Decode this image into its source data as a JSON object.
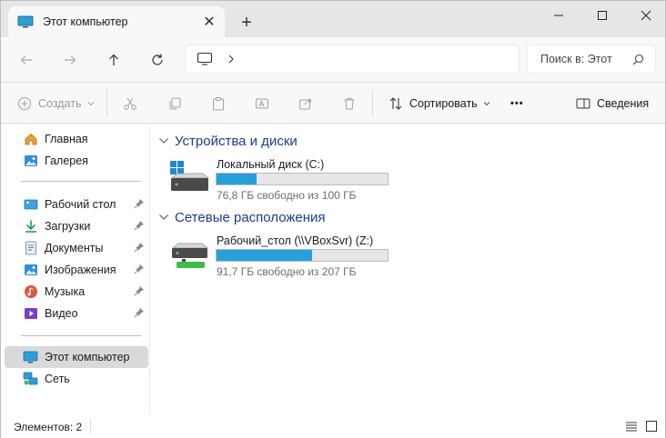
{
  "tab": {
    "title": "Этот компьютер",
    "close": "✕",
    "new_tab": "+"
  },
  "window": {
    "minimize": "—",
    "maximize": "☐",
    "close": "✕"
  },
  "nav": {
    "back": "back-arrow-icon",
    "forward": "forward-arrow-icon",
    "up": "up-arrow-icon",
    "refresh": "refresh-icon"
  },
  "address": {
    "path_chevron": "›"
  },
  "search": {
    "placeholder": "Поиск в: Этот компьютер",
    "shown": "Поиск в: Этот"
  },
  "toolbar": {
    "create": "Создать",
    "sort": "Сортировать",
    "more": "•••",
    "details": "Сведения"
  },
  "sidebar": {
    "items": [
      {
        "label": "Главная",
        "icon": "home-icon"
      },
      {
        "label": "Галерея",
        "icon": "gallery-icon"
      },
      {
        "label": "Рабочий стол",
        "icon": "desktop-icon",
        "pinned": true
      },
      {
        "label": "Загрузки",
        "icon": "downloads-icon",
        "pinned": true
      },
      {
        "label": "Документы",
        "icon": "documents-icon",
        "pinned": true
      },
      {
        "label": "Изображения",
        "icon": "pictures-icon",
        "pinned": true
      },
      {
        "label": "Музыка",
        "icon": "music-icon",
        "pinned": true
      },
      {
        "label": "Видео",
        "icon": "video-icon",
        "pinned": true
      },
      {
        "label": "Этот компьютер",
        "icon": "this-pc-icon",
        "selected": true
      },
      {
        "label": "Сеть",
        "icon": "network-icon"
      }
    ]
  },
  "groups": [
    {
      "title": "Устройства и диски",
      "drives": [
        {
          "name": "Локальный диск (C:)",
          "free_text": "76,8 ГБ свободно из 100 ГБ",
          "used_fraction": 0.232
        }
      ]
    },
    {
      "title": "Сетевые расположения",
      "drives": [
        {
          "name": "Рабочий_стол (\\\\VBoxSvr) (Z:)",
          "free_text": "91,7 ГБ свободно из 207 ГБ",
          "used_fraction": 0.557
        }
      ]
    }
  ],
  "status": {
    "items": "Элементов: 2"
  },
  "colors": {
    "accent": "#26a0da",
    "group_title": "#1a3d8f",
    "selected": "#d9d9d9"
  }
}
